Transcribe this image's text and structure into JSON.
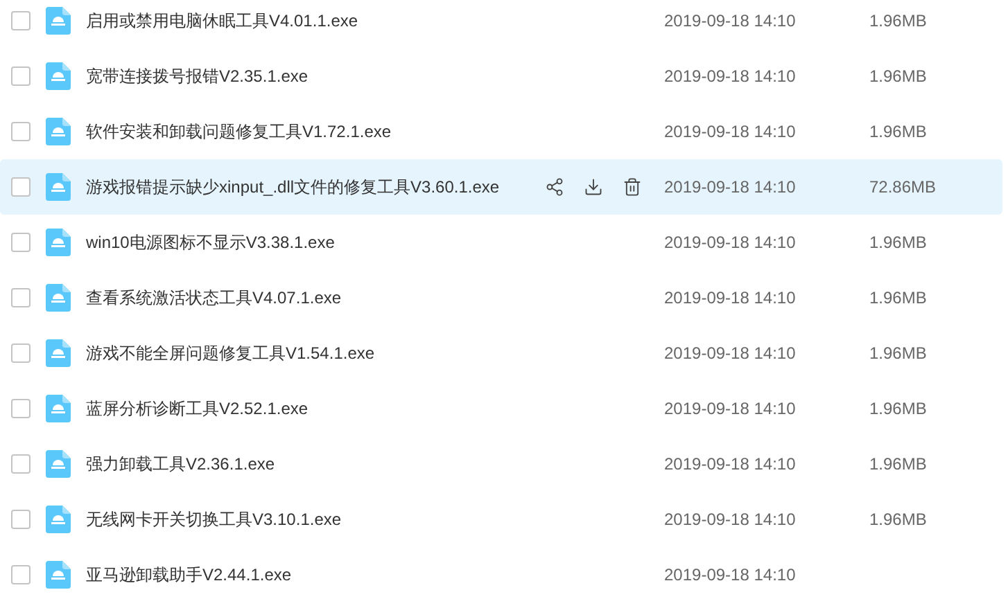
{
  "files": [
    {
      "name": "启用或禁用电脑休眠工具V4.01.1.exe",
      "time": "2019-09-18 14:10",
      "size": "1.96MB",
      "checked": false,
      "highlighted": false
    },
    {
      "name": "宽带连接拨号报错V2.35.1.exe",
      "time": "2019-09-18 14:10",
      "size": "1.96MB",
      "checked": false,
      "highlighted": false
    },
    {
      "name": "软件安装和卸载问题修复工具V1.72.1.exe",
      "time": "2019-09-18 14:10",
      "size": "1.96MB",
      "checked": false,
      "highlighted": false
    },
    {
      "name": "游戏报错提示缺少xinput_.dll文件的修复工具V3.60.1.exe",
      "time": "2019-09-18 14:10",
      "size": "72.86MB",
      "checked": false,
      "highlighted": true
    },
    {
      "name": "win10电源图标不显示V3.38.1.exe",
      "time": "2019-09-18 14:10",
      "size": "1.96MB",
      "checked": false,
      "highlighted": false
    },
    {
      "name": "查看系统激活状态工具V4.07.1.exe",
      "time": "2019-09-18 14:10",
      "size": "1.96MB",
      "checked": false,
      "highlighted": false
    },
    {
      "name": "游戏不能全屏问题修复工具V1.54.1.exe",
      "time": "2019-09-18 14:10",
      "size": "1.96MB",
      "checked": false,
      "highlighted": false
    },
    {
      "name": "蓝屏分析诊断工具V2.52.1.exe",
      "time": "2019-09-18 14:10",
      "size": "1.96MB",
      "checked": false,
      "highlighted": false
    },
    {
      "name": "强力卸载工具V2.36.1.exe",
      "time": "2019-09-18 14:10",
      "size": "1.96MB",
      "checked": false,
      "highlighted": false
    },
    {
      "name": "无线网卡开关切换工具V3.10.1.exe",
      "time": "2019-09-18 14:10",
      "size": "1.96MB",
      "checked": false,
      "highlighted": false
    },
    {
      "name": "亚马逊卸载助手V2.44.1.exe",
      "time": "2019-09-18 14:10",
      "checked": false,
      "highlighted": false
    }
  ]
}
